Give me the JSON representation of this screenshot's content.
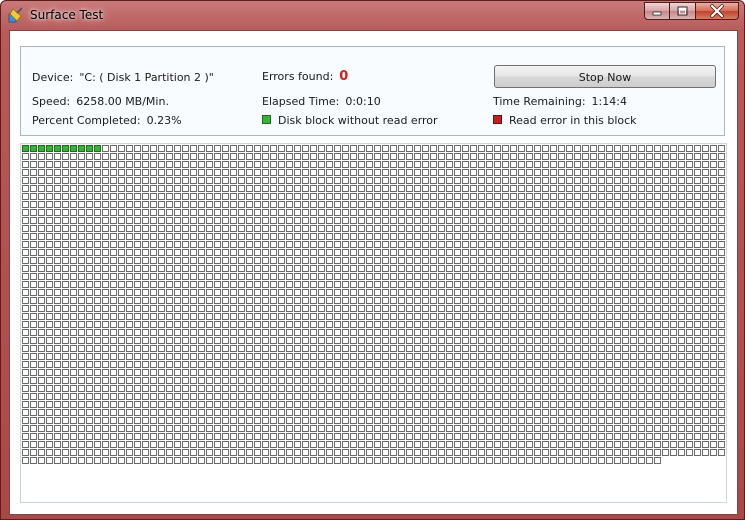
{
  "window": {
    "title": "Surface Test",
    "icon": "surface-test-app-icon",
    "buttons": [
      "minimize",
      "maximize",
      "close"
    ]
  },
  "info": {
    "device_label": "Device:",
    "device_value": "\"C: ( Disk 1 Partition 2 )\"",
    "speed_label": "Speed:",
    "speed_value": "6258.00 MB/Min.",
    "percent_label": "Percent Completed:",
    "percent_value": "0.23%",
    "errors_label": "Errors found:",
    "errors_value": "0",
    "elapsed_label": "Elapsed Time:",
    "elapsed_value": "0:0:10",
    "remaining_label": "Time Remaining:",
    "remaining_value": "1:14:4",
    "stop_button": "Stop Now"
  },
  "legend": {
    "ok_label": "Disk block without read error",
    "ok_color": "#38b338",
    "error_label": "Read error in this block",
    "error_color": "#c41e1e"
  },
  "blocks": {
    "columns": 88,
    "total": 3512,
    "tested_ok": 10,
    "read_errors": 0,
    "ok_color": "#38b338",
    "untested_border": "#6b6b6b"
  }
}
